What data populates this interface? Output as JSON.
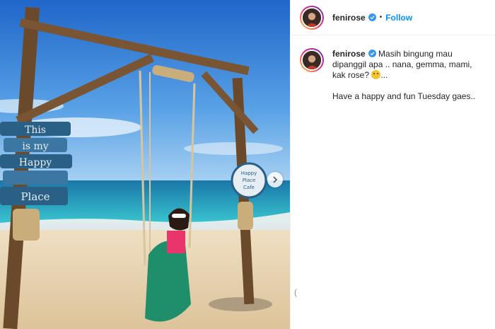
{
  "post": {
    "username": "fenirose",
    "separator": "•",
    "follow_label": "Follow",
    "caption_line1": "Masih bingung mau dipanggil apa .. nana, gemma, mami, kak rose?",
    "caption_ellipsis": "...",
    "caption_line2": "Have a happy and fun Tuesday gaes..",
    "emoji": "thinking-face-emoji"
  },
  "photo": {
    "sign_left": [
      "This",
      "is my",
      "Happy",
      "Place"
    ],
    "sign_right": [
      "Happy",
      "Place",
      "Cafe"
    ],
    "description": "beach swing photo"
  },
  "colors": {
    "follow": "#0095f6",
    "verified": "#3897f0",
    "sky": "#3f86d8",
    "sea": "#2a9fc2",
    "sand": "#e9d6b4"
  }
}
